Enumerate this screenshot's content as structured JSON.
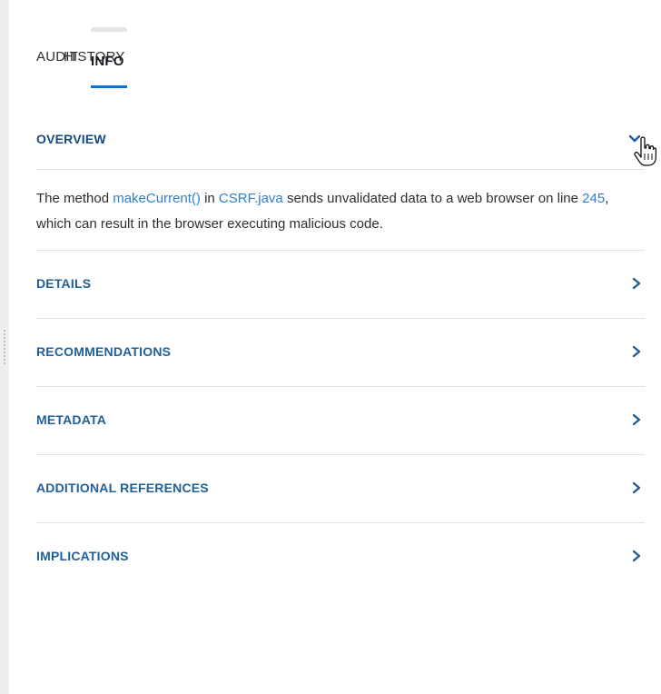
{
  "tabs": [
    {
      "label": "AUDIT",
      "active": false
    },
    {
      "label": "HISTORY",
      "active": false
    },
    {
      "label": "INFO",
      "active": true
    }
  ],
  "overview": {
    "title": "OVERVIEW",
    "expanded": true,
    "text": {
      "prefix": "The method ",
      "method_link": "makeCurrent()",
      "middle1": " in ",
      "file_link": "CSRF.java",
      "middle2": " sends unvalidated data to a web browser on line ",
      "line_link": "245",
      "suffix": ", which can result in the browser executing malicious code."
    }
  },
  "sections": [
    {
      "title": "DETAILS"
    },
    {
      "title": "RECOMMENDATIONS"
    },
    {
      "title": "METADATA"
    },
    {
      "title": "ADDITIONAL REFERENCES"
    },
    {
      "title": "IMPLICATIONS"
    }
  ],
  "icons": {
    "expand": "chevron-down-icon",
    "collapsed": "chevron-right-icon",
    "pointer": "hand-pointer-cursor"
  },
  "colors": {
    "heading": "#1f5f9a",
    "link": "#2f7fcf",
    "active_tab_underline": "#0a73d9",
    "divider": "#dfe2e5"
  }
}
